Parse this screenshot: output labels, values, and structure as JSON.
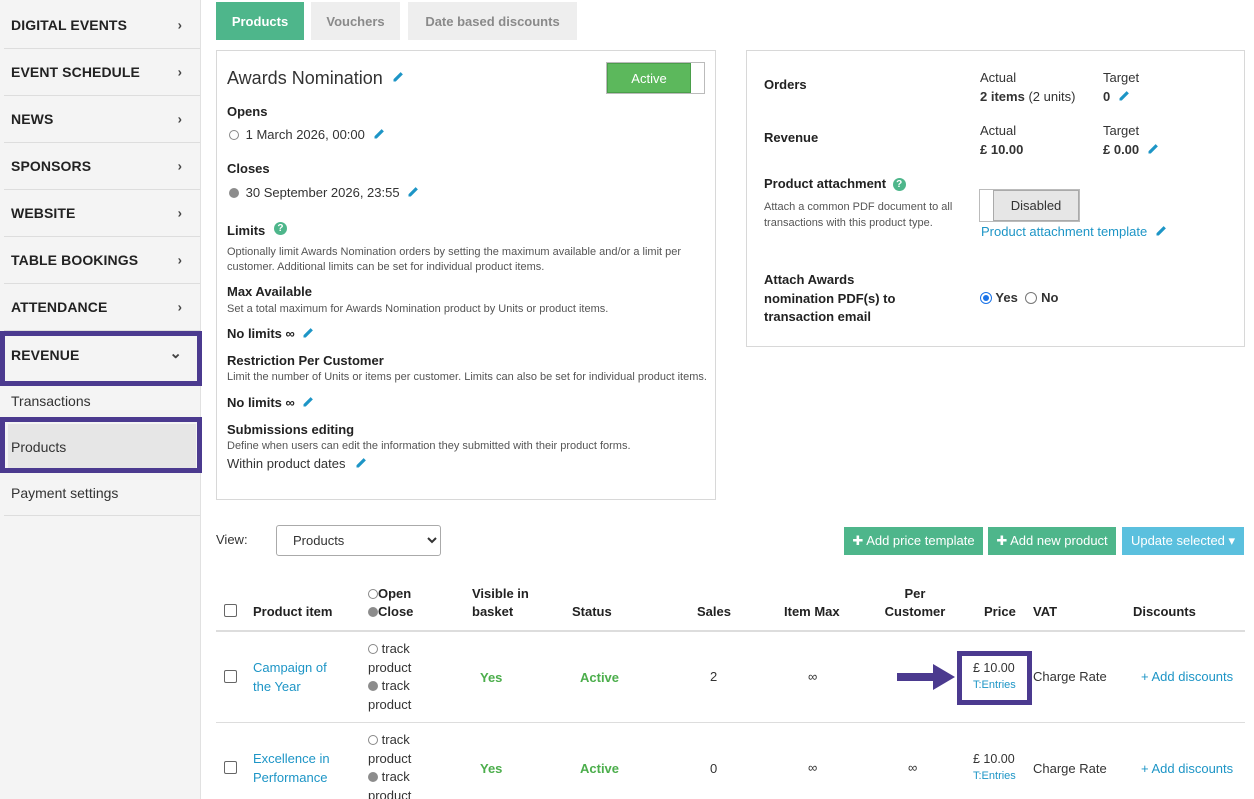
{
  "sidebar": {
    "items": [
      {
        "label": "DIGITAL EVENTS",
        "chevron": "›"
      },
      {
        "label": "EVENT SCHEDULE",
        "chevron": "›"
      },
      {
        "label": "NEWS",
        "chevron": "›"
      },
      {
        "label": "SPONSORS",
        "chevron": "›"
      },
      {
        "label": "WEBSITE",
        "chevron": "›"
      },
      {
        "label": "TABLE BOOKINGS",
        "chevron": "›"
      },
      {
        "label": "ATTENDANCE",
        "chevron": "›"
      },
      {
        "label": "REVENUE",
        "chevron": "⌄"
      }
    ],
    "subitems": [
      {
        "label": "Transactions"
      },
      {
        "label": "Products"
      },
      {
        "label": "Payment settings"
      }
    ],
    "highlight_color": "#4b3a8f"
  },
  "tabs": [
    {
      "label": "Products",
      "active": true
    },
    {
      "label": "Vouchers",
      "active": false
    },
    {
      "label": "Date based discounts",
      "active": false
    }
  ],
  "product": {
    "title": "Awards Nomination",
    "status_toggle": "Active",
    "opens_label": "Opens",
    "opens_value": "1 March 2026, 00:00",
    "closes_label": "Closes",
    "closes_value": "30 September 2026, 23:55",
    "limits_label": "Limits",
    "limits_desc": "Optionally limit Awards Nomination orders by setting the maximum available and/or a limit per customer. Additional limits can be set for individual product items.",
    "max_available_label": "Max Available",
    "max_available_desc": "Set a total maximum for Awards Nomination product by Units or product items.",
    "max_available_value": "No limits ∞",
    "restriction_label": "Restriction Per Customer",
    "restriction_desc": "Limit the number of Units or items per customer. Limits can also be set for individual product items.",
    "restriction_value": "No limits ∞",
    "submissions_label": "Submissions editing",
    "submissions_desc": "Define when users can edit the information they submitted with their product forms.",
    "submissions_value": "Within product dates"
  },
  "stats": {
    "orders_label": "Orders",
    "actual_label": "Actual",
    "target_label": "Target",
    "orders_actual_bold": "2 items",
    "orders_actual_extra": "(2 units)",
    "orders_target": "0",
    "revenue_label": "Revenue",
    "revenue_actual": "£ 10.00",
    "revenue_target": "£ 0.00",
    "attachment_label": "Product attachment",
    "attachment_desc": "Attach a common PDF document to all transactions with this product type.",
    "attachment_toggle": "Disabled",
    "attachment_template_link": "Product attachment template",
    "attach_pdf_label": "Attach Awards nomination PDF(s) to transaction email",
    "attach_yes": "Yes",
    "attach_no": "No"
  },
  "toolbar": {
    "view_label": "View:",
    "view_selected": "Products",
    "add_price_template": "✚ Add price template",
    "add_new_product": "✚ Add new product",
    "update_selected": "Update selected ▾"
  },
  "table": {
    "headers": {
      "product_item": "Product item",
      "open": "Open",
      "close": "Close",
      "visible": "Visible in basket",
      "status": "Status",
      "sales": "Sales",
      "item_max": "Item Max",
      "per_customer": "Per Customer",
      "price": "Price",
      "vat": "VAT",
      "discounts": "Discounts"
    },
    "rows": [
      {
        "name": "Campaign of the Year",
        "open_track": "track product",
        "close_track": "track product",
        "visible": "Yes",
        "status": "Active",
        "sales": "2",
        "item_max": "∞",
        "per_customer": "",
        "price": "£ 10.00",
        "price_tag": "T:Entries",
        "vat": "Charge Rate",
        "discounts": "+ Add discounts"
      },
      {
        "name": "Excellence in Performance",
        "open_track": "track product",
        "close_track": "track product",
        "visible": "Yes",
        "status": "Active",
        "sales": "0",
        "item_max": "∞",
        "per_customer": "∞",
        "price": "£ 10.00",
        "price_tag": "T:Entries",
        "vat": "Charge Rate",
        "discounts": "+ Add discounts"
      }
    ]
  },
  "icons": {
    "edit": "pencil-icon",
    "help": "question-icon",
    "arrow": "arrow-right-icon"
  },
  "colors": {
    "accent_green": "#4eb68b",
    "active_green": "#5cb85c",
    "link_blue": "#1d95c6",
    "update_blue": "#5bc0de",
    "annotation_purple": "#4b3a8f"
  }
}
